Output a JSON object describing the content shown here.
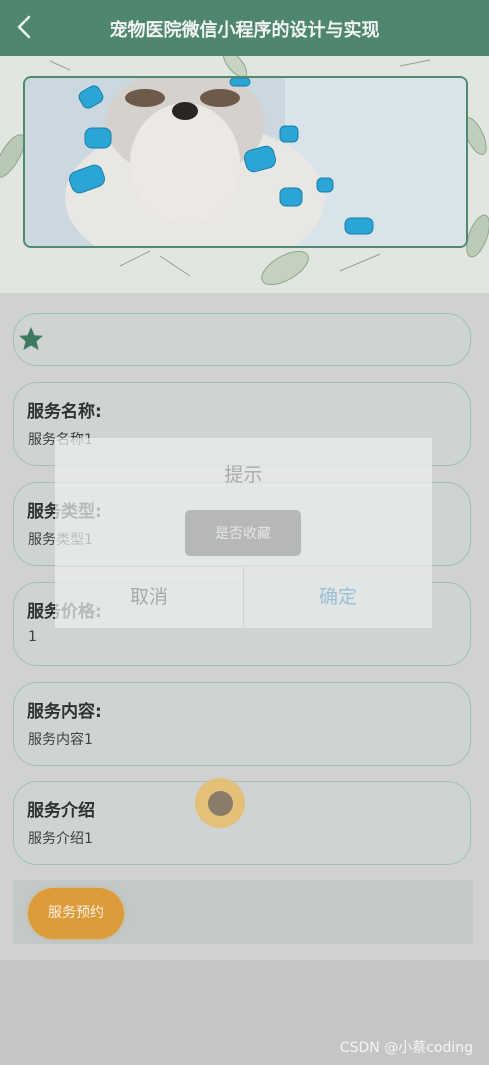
{
  "header": {
    "title": "宠物医院微信小程序的设计与实现"
  },
  "fields": [
    {
      "label": "服务名称:",
      "value": "服务名称1"
    },
    {
      "label": "服务类型:",
      "value": "服务类型1"
    },
    {
      "label": "服务价格:",
      "value": "1"
    },
    {
      "label": "服务内容:",
      "value": "服务内容1"
    },
    {
      "label": "服务介绍",
      "value": "服务介绍1"
    }
  ],
  "actions": {
    "book_label": "服务预约"
  },
  "dialog": {
    "title": "提示",
    "message": "是否收藏",
    "cancel_label": "取消",
    "confirm_label": "确定"
  },
  "watermark": "CSDN @小蔡coding",
  "colors": {
    "header": "#4f8670",
    "accent": "#dd9b3a",
    "border": "#9fc2b4"
  },
  "icons": [
    "back-icon",
    "star-icon"
  ]
}
